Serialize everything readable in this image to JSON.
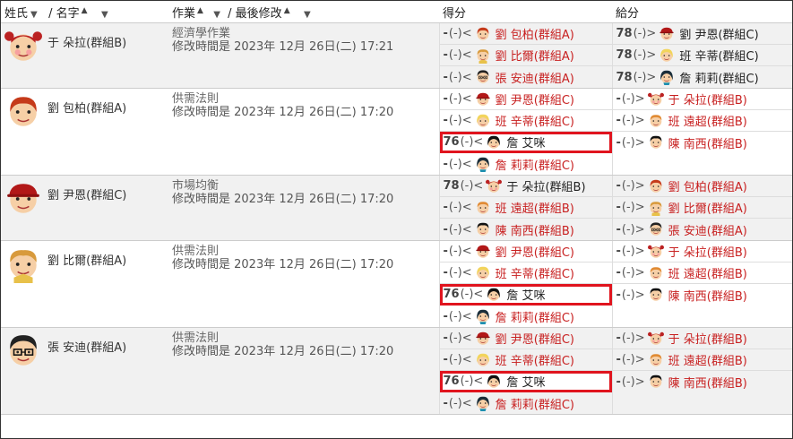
{
  "header": {
    "surname": "姓氏",
    "slash_name": "/ 名字",
    "assignment": "作業",
    "slash_modified": "/ 最後修改",
    "received": "得分",
    "given": "給分"
  },
  "rows": [
    {
      "name": "于 朵拉(群組B)",
      "face": "pigtail-girl",
      "title": "經濟學作業",
      "modified": "修改時間是 2023年 12月 26日(二) 17:21",
      "received": [
        {
          "score": "-",
          "par": "(-)<",
          "face": "red-boy",
          "name": "劉 包柏(群組A)",
          "color": "red",
          "hl": false
        },
        {
          "score": "-",
          "par": "(-)<",
          "face": "blond-boy",
          "name": "劉 比爾(群組A)",
          "color": "red",
          "hl": false
        },
        {
          "score": "-",
          "par": "(-)<",
          "face": "glasses-boy",
          "name": "張 安迪(群組A)",
          "color": "red",
          "hl": false
        }
      ],
      "given": [
        {
          "score": "78",
          "par": "(-)>",
          "face": "red-cap-boy",
          "name": "劉 尹恩(群組C)",
          "color": "blk"
        },
        {
          "score": "78",
          "par": "(-)>",
          "face": "blonde-girl",
          "name": "班 辛蒂(群組C)",
          "color": "blk"
        },
        {
          "score": "78",
          "par": "(-)>",
          "face": "teal-girl",
          "name": "詹 莉莉(群組C)",
          "color": "blk"
        }
      ]
    },
    {
      "name": "劉 包柏(群組A)",
      "face": "red-boy",
      "title": "供需法則",
      "modified": "修改時間是 2023年 12月 26日(二) 17:20",
      "received": [
        {
          "score": "-",
          "par": "(-)<",
          "face": "red-cap-boy",
          "name": "劉 尹恩(群組C)",
          "color": "red",
          "hl": false
        },
        {
          "score": "-",
          "par": "(-)<",
          "face": "blonde-girl",
          "name": "班 辛蒂(群組C)",
          "color": "red",
          "hl": false
        },
        {
          "score": "76",
          "par": "(-)<",
          "face": "dark-girl",
          "name": "詹 艾咪",
          "color": "blk",
          "hl": true
        },
        {
          "score": "-",
          "par": "(-)<",
          "face": "teal-girl",
          "name": "詹 莉莉(群組C)",
          "color": "red",
          "hl": false
        }
      ],
      "given": [
        {
          "score": "-",
          "par": "(-)>",
          "face": "pigtail-girl",
          "name": "于 朵拉(群組B)",
          "color": "red"
        },
        {
          "score": "-",
          "par": "(-)>",
          "face": "orange-boy",
          "name": "班 遠超(群組B)",
          "color": "red"
        },
        {
          "score": "-",
          "par": "(-)>",
          "face": "black-hair-boy",
          "name": "陳 南西(群組B)",
          "color": "red"
        }
      ]
    },
    {
      "name": "劉 尹恩(群組C)",
      "face": "red-cap-boy",
      "title": "市場均衡",
      "modified": "修改時間是 2023年 12月 26日(二) 17:20",
      "received": [
        {
          "score": "78",
          "par": "(-)<",
          "face": "pigtail-girl",
          "name": "于 朵拉(群組B)",
          "color": "blk",
          "hl": false
        },
        {
          "score": "-",
          "par": "(-)<",
          "face": "orange-boy",
          "name": "班 遠超(群組B)",
          "color": "red",
          "hl": false
        },
        {
          "score": "-",
          "par": "(-)<",
          "face": "black-hair-boy",
          "name": "陳 南西(群組B)",
          "color": "red",
          "hl": false
        }
      ],
      "given": [
        {
          "score": "-",
          "par": "(-)>",
          "face": "red-boy",
          "name": "劉 包柏(群組A)",
          "color": "red"
        },
        {
          "score": "-",
          "par": "(-)>",
          "face": "blond-boy",
          "name": "劉 比爾(群組A)",
          "color": "red"
        },
        {
          "score": "-",
          "par": "(-)>",
          "face": "glasses-boy",
          "name": "張 安迪(群組A)",
          "color": "red"
        }
      ]
    },
    {
      "name": "劉 比爾(群組A)",
      "face": "blond-boy",
      "title": "供需法則",
      "modified": "修改時間是 2023年 12月 26日(二) 17:20",
      "received": [
        {
          "score": "-",
          "par": "(-)<",
          "face": "red-cap-boy",
          "name": "劉 尹恩(群組C)",
          "color": "red",
          "hl": false
        },
        {
          "score": "-",
          "par": "(-)<",
          "face": "blonde-girl",
          "name": "班 辛蒂(群組C)",
          "color": "red",
          "hl": false
        },
        {
          "score": "76",
          "par": "(-)<",
          "face": "dark-girl",
          "name": "詹 艾咪",
          "color": "blk",
          "hl": true
        },
        {
          "score": "-",
          "par": "(-)<",
          "face": "teal-girl",
          "name": "詹 莉莉(群組C)",
          "color": "red",
          "hl": false
        }
      ],
      "given": [
        {
          "score": "-",
          "par": "(-)>",
          "face": "pigtail-girl",
          "name": "于 朵拉(群組B)",
          "color": "red"
        },
        {
          "score": "-",
          "par": "(-)>",
          "face": "orange-boy",
          "name": "班 遠超(群組B)",
          "color": "red"
        },
        {
          "score": "-",
          "par": "(-)>",
          "face": "black-hair-boy",
          "name": "陳 南西(群組B)",
          "color": "red"
        }
      ]
    },
    {
      "name": "張 安迪(群組A)",
      "face": "glasses-boy",
      "title": "供需法則",
      "modified": "修改時間是 2023年 12月 26日(二) 17:20",
      "received": [
        {
          "score": "-",
          "par": "(-)<",
          "face": "red-cap-boy",
          "name": "劉 尹恩(群組C)",
          "color": "red",
          "hl": false
        },
        {
          "score": "-",
          "par": "(-)<",
          "face": "blonde-girl",
          "name": "班 辛蒂(群組C)",
          "color": "red",
          "hl": false
        },
        {
          "score": "76",
          "par": "(-)<",
          "face": "dark-girl",
          "name": "詹 艾咪",
          "color": "blk",
          "hl": true
        },
        {
          "score": "-",
          "par": "(-)<",
          "face": "teal-girl",
          "name": "詹 莉莉(群組C)",
          "color": "red",
          "hl": false
        }
      ],
      "given": [
        {
          "score": "-",
          "par": "(-)>",
          "face": "pigtail-girl",
          "name": "于 朵拉(群組B)",
          "color": "red"
        },
        {
          "score": "-",
          "par": "(-)>",
          "face": "orange-boy",
          "name": "班 遠超(群組B)",
          "color": "red"
        },
        {
          "score": "-",
          "par": "(-)>",
          "face": "black-hair-boy",
          "name": "陳 南西(群組B)",
          "color": "red"
        }
      ]
    }
  ],
  "colors": {
    "highlight": "#e0141e",
    "name_red": "#c82020",
    "row_alt": "#f1f1f1"
  }
}
